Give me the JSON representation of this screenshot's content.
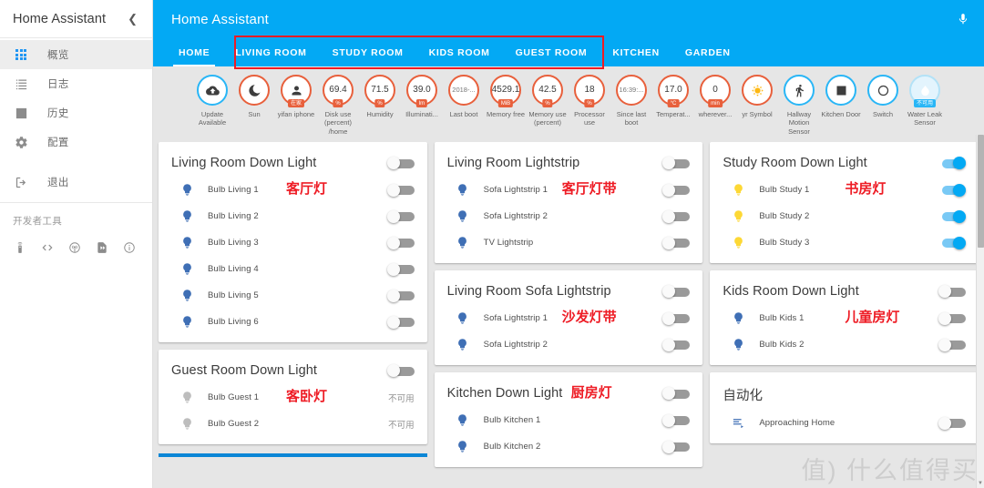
{
  "sidebar": {
    "title": "Home Assistant",
    "collapse_icon": "chevron-left-icon",
    "items": [
      {
        "label": "概览",
        "icon": "grid-icon",
        "active": true
      },
      {
        "label": "日志",
        "icon": "list-icon",
        "active": false
      },
      {
        "label": "历史",
        "icon": "chart-bar-icon",
        "active": false
      },
      {
        "label": "配置",
        "icon": "gear-icon",
        "active": false
      },
      {
        "label": "退出",
        "icon": "logout-icon",
        "active": false
      }
    ],
    "dev_tools_title": "开发者工具",
    "dev_tools_icons": [
      "remote-icon",
      "code-icon",
      "broadcast-icon",
      "template-file-icon",
      "info-icon"
    ]
  },
  "header": {
    "title": "Home Assistant",
    "mic_icon": "microphone-icon",
    "tabs": [
      {
        "label": "HOME",
        "active": true
      },
      {
        "label": "LIVING ROOM",
        "active": false
      },
      {
        "label": "STUDY ROOM",
        "active": false
      },
      {
        "label": "KIDS ROOM",
        "active": false
      },
      {
        "label": "GUEST ROOM",
        "active": false
      },
      {
        "label": "KITCHEN",
        "active": false
      },
      {
        "label": "GARDEN",
        "active": false
      }
    ],
    "accent_color": "#03a9f4",
    "annotation_color": "#ee1c25"
  },
  "badges": [
    {
      "value": "",
      "icon": "cloud-upload-icon",
      "unit": "",
      "label": "Update Available",
      "ring": "blue"
    },
    {
      "value": "",
      "icon": "moon-icon",
      "unit": "",
      "label": "Sun",
      "ring": "orange"
    },
    {
      "value": "",
      "icon": "person-icon",
      "unit": "在家",
      "label": "yifan iphone",
      "ring": "orange"
    },
    {
      "value": "69.4",
      "icon": "",
      "unit": "%",
      "label": "Disk use (percent) /home",
      "ring": "orange"
    },
    {
      "value": "71.5",
      "icon": "",
      "unit": "%",
      "label": "Humidity",
      "ring": "orange"
    },
    {
      "value": "39.0",
      "icon": "",
      "unit": "lm",
      "label": "Illuminati...",
      "ring": "orange"
    },
    {
      "value": "2018-...",
      "icon": "",
      "unit": "",
      "label": "Last boot",
      "ring": "orange",
      "small": true
    },
    {
      "value": "4529.1",
      "icon": "",
      "unit": "MiB",
      "label": "Memory free",
      "ring": "orange"
    },
    {
      "value": "42.5",
      "icon": "",
      "unit": "%",
      "label": "Memory use (percent)",
      "ring": "orange"
    },
    {
      "value": "18",
      "icon": "",
      "unit": "%",
      "label": "Processor use",
      "ring": "orange"
    },
    {
      "value": "16:39:...",
      "icon": "",
      "unit": "",
      "label": "Since last boot",
      "ring": "orange",
      "small": true
    },
    {
      "value": "17.0",
      "icon": "",
      "unit": "°C",
      "label": "Temperat...",
      "ring": "orange"
    },
    {
      "value": "0",
      "icon": "",
      "unit": "min",
      "label": "wherever...",
      "ring": "orange"
    },
    {
      "value": "",
      "icon": "sun-icon",
      "unit": "",
      "label": "yr Symbol",
      "ring": "orange"
    },
    {
      "value": "",
      "icon": "walk-icon",
      "unit": "",
      "label": "Hallway Motion Sensor",
      "ring": "blue"
    },
    {
      "value": "",
      "icon": "square-icon",
      "unit": "",
      "label": "Kitchen Door",
      "ring": "blue"
    },
    {
      "value": "",
      "icon": "circle-icon",
      "unit": "",
      "label": "Switch",
      "ring": "blue"
    },
    {
      "value": "",
      "icon": "water-drop-icon",
      "unit": "不可用",
      "label": "Water Leak Sensor",
      "ring": "blue",
      "filled": true
    }
  ],
  "columns": [
    {
      "cards": [
        {
          "title": "Living Room Down Light",
          "note": "客厅灯",
          "header_toggle": "off",
          "rows": [
            {
              "name": "Bulb Living 1",
              "bulb": "blue",
              "toggle": "off"
            },
            {
              "name": "Bulb Living 2",
              "bulb": "blue",
              "toggle": "off"
            },
            {
              "name": "Bulb Living 3",
              "bulb": "blue",
              "toggle": "off"
            },
            {
              "name": "Bulb Living 4",
              "bulb": "blue",
              "toggle": "off"
            },
            {
              "name": "Bulb Living 5",
              "bulb": "blue",
              "toggle": "off"
            },
            {
              "name": "Bulb Living 6",
              "bulb": "blue",
              "toggle": "off"
            }
          ]
        },
        {
          "title": "Guest Room Down Light",
          "note": "客卧灯",
          "header_toggle": "off",
          "rows": [
            {
              "name": "Bulb Guest 1",
              "bulb": "grey",
              "toggle": "unavailable",
              "status": "不可用"
            },
            {
              "name": "Bulb Guest 2",
              "bulb": "grey",
              "toggle": "unavailable",
              "status": "不可用"
            }
          ]
        }
      ]
    },
    {
      "cards": [
        {
          "title": "Living Room Lightstrip",
          "note": "客厅灯带",
          "header_toggle": "off",
          "rows": [
            {
              "name": "Sofa Lightstrip 1",
              "bulb": "blue",
              "toggle": "off"
            },
            {
              "name": "Sofa Lightstrip 2",
              "bulb": "blue",
              "toggle": "off"
            },
            {
              "name": "TV Lightstrip",
              "bulb": "blue",
              "toggle": "off"
            }
          ]
        },
        {
          "title": "Living Room Sofa Lightstrip",
          "note": "沙发灯带",
          "header_toggle": "off",
          "rows": [
            {
              "name": "Sofa Lightstrip 1",
              "bulb": "blue",
              "toggle": "off"
            },
            {
              "name": "Sofa Lightstrip 2",
              "bulb": "blue",
              "toggle": "off"
            }
          ]
        },
        {
          "title": "Kitchen Down Light",
          "note": "厨房灯",
          "header_toggle": "off",
          "rows": [
            {
              "name": "Bulb Kitchen 1",
              "bulb": "blue",
              "toggle": "off"
            },
            {
              "name": "Bulb Kitchen 2",
              "bulb": "blue",
              "toggle": "off"
            }
          ]
        }
      ]
    },
    {
      "cards": [
        {
          "title": "Study Room Down Light",
          "note": "书房灯",
          "header_toggle": "on",
          "rows": [
            {
              "name": "Bulb Study 1",
              "bulb": "yellow",
              "toggle": "on"
            },
            {
              "name": "Bulb Study 2",
              "bulb": "yellow",
              "toggle": "on"
            },
            {
              "name": "Bulb Study 3",
              "bulb": "yellow",
              "toggle": "on"
            }
          ]
        },
        {
          "title": "Kids Room Down Light",
          "note": "儿童房灯",
          "header_toggle": "off",
          "rows": [
            {
              "name": "Bulb Kids 1",
              "bulb": "blue",
              "toggle": "off"
            },
            {
              "name": "Bulb Kids 2",
              "bulb": "blue",
              "toggle": "off"
            }
          ]
        },
        {
          "title": "自动化",
          "note": "",
          "header_toggle": "none",
          "rows": [
            {
              "name": "Approaching Home",
              "bulb": "automation",
              "toggle": "off"
            }
          ]
        }
      ]
    }
  ],
  "watermark": "值) 什么值得买"
}
